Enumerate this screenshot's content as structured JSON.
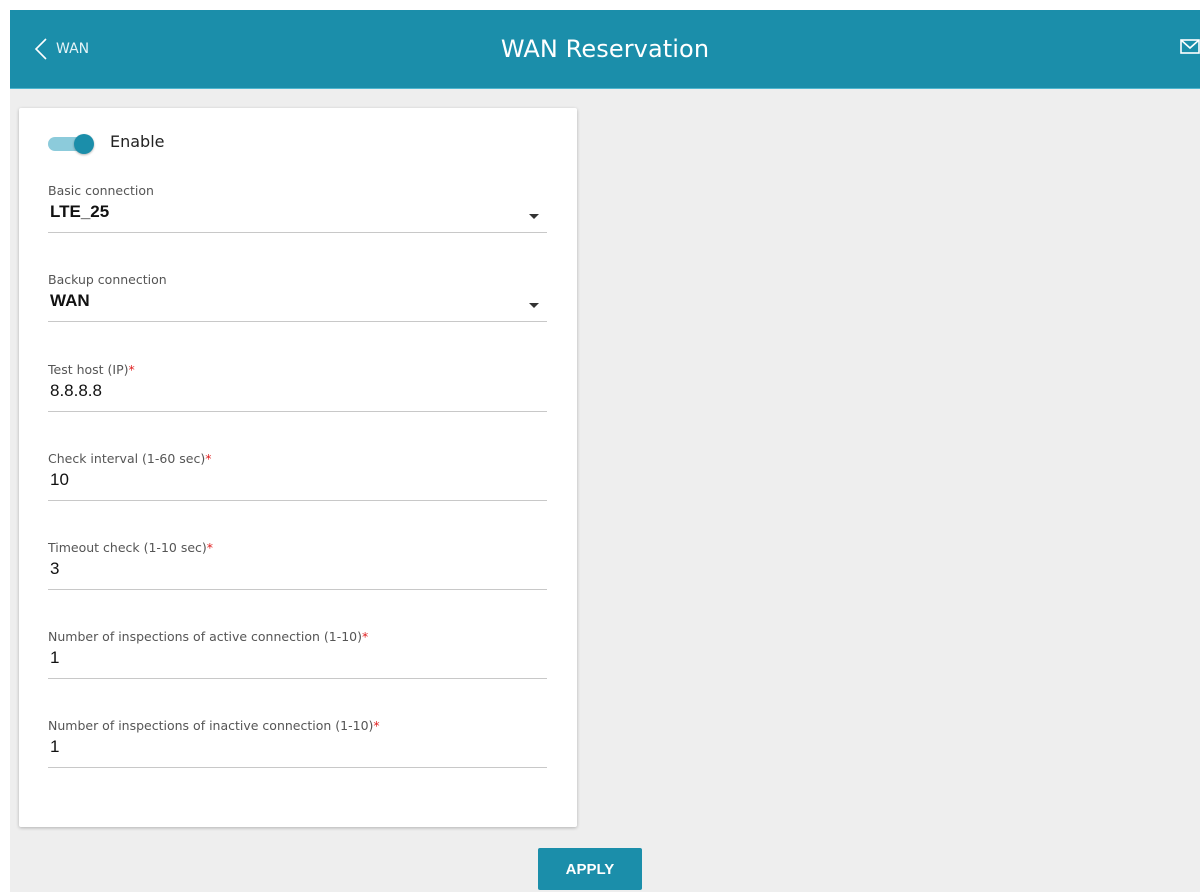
{
  "header": {
    "back_label": "WAN",
    "title": "WAN Reservation",
    "color": "#1b8eaa"
  },
  "icons": {
    "back": "chevron-left-icon",
    "mail": "envelope-icon"
  },
  "form": {
    "enable": {
      "label": "Enable",
      "checked": true
    },
    "basic_connection": {
      "label": "Basic connection",
      "value": "LTE_25"
    },
    "backup_connection": {
      "label": "Backup connection",
      "value": "WAN"
    },
    "test_host": {
      "label": "Test host (IP)",
      "required_mark": "*",
      "value": "8.8.8.8"
    },
    "check_interval": {
      "label": "Check interval (1-60 sec)",
      "required_mark": "*",
      "value": "10"
    },
    "timeout_check": {
      "label": "Timeout check (1-10 sec)",
      "required_mark": "*",
      "value": "3"
    },
    "inspections_active": {
      "label": "Number of inspections of active connection (1-10)",
      "required_mark": "*",
      "value": "1"
    },
    "inspections_inactive": {
      "label": "Number of inspections of inactive connection (1-10)",
      "required_mark": "*",
      "value": "1"
    }
  },
  "actions": {
    "apply_label": "APPLY"
  }
}
